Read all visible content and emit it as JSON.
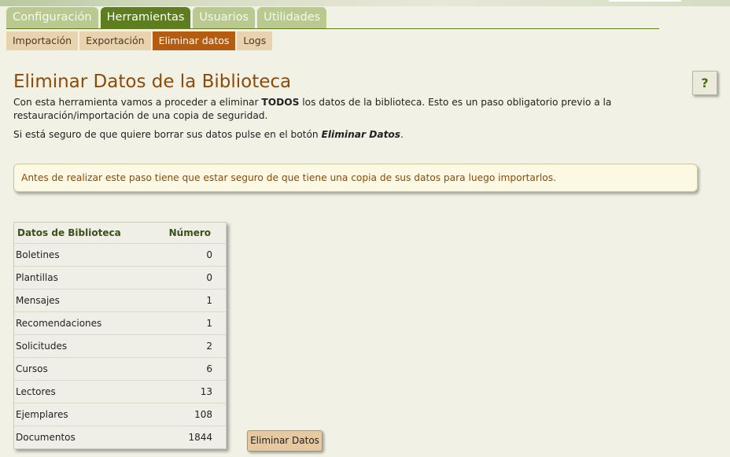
{
  "main_tabs": [
    {
      "label": "Configuración",
      "active": false
    },
    {
      "label": "Herramientas",
      "active": true
    },
    {
      "label": "Usuarios",
      "active": false
    },
    {
      "label": "Utilidades",
      "active": false
    }
  ],
  "sub_tabs": [
    {
      "label": "Importación",
      "active": false
    },
    {
      "label": "Exportación",
      "active": false
    },
    {
      "label": "Eliminar datos",
      "active": true
    },
    {
      "label": "Logs",
      "active": false
    }
  ],
  "page_title": "Eliminar Datos de la Biblioteca",
  "help_label": "?",
  "intro": {
    "part1": "Con esta herramienta vamos a proceder a eliminar ",
    "bold": "TODOS",
    "part2": " los datos de la biblioteca. Esto es un paso obligatorio previo a la restauración/importación de una copia de seguridad."
  },
  "instruction": {
    "part1": "Si está seguro de que quiere borrar sus datos pulse en el botón ",
    "emphasis": "Eliminar Datos",
    "part2": "."
  },
  "warning": "Antes de realizar este paso tiene que estar seguro de que tiene una copia de sus datos para luego importarlos.",
  "table": {
    "headers": [
      "Datos de Biblioteca",
      "Número"
    ],
    "rows": [
      {
        "label": "Boletines",
        "value": "0"
      },
      {
        "label": "Plantillas",
        "value": "0"
      },
      {
        "label": "Mensajes",
        "value": "1"
      },
      {
        "label": "Recomendaciones",
        "value": "1"
      },
      {
        "label": "Solicitudes",
        "value": "2"
      },
      {
        "label": "Cursos",
        "value": "6"
      },
      {
        "label": "Lectores",
        "value": "13"
      },
      {
        "label": "Ejemplares",
        "value": "108"
      },
      {
        "label": "Documentos",
        "value": "1844"
      }
    ]
  },
  "delete_button": "Eliminar Datos",
  "colors": {
    "active_main_tab": "#5d7d1f",
    "active_sub_tab": "#b35c12",
    "title": "#8e4a06"
  }
}
